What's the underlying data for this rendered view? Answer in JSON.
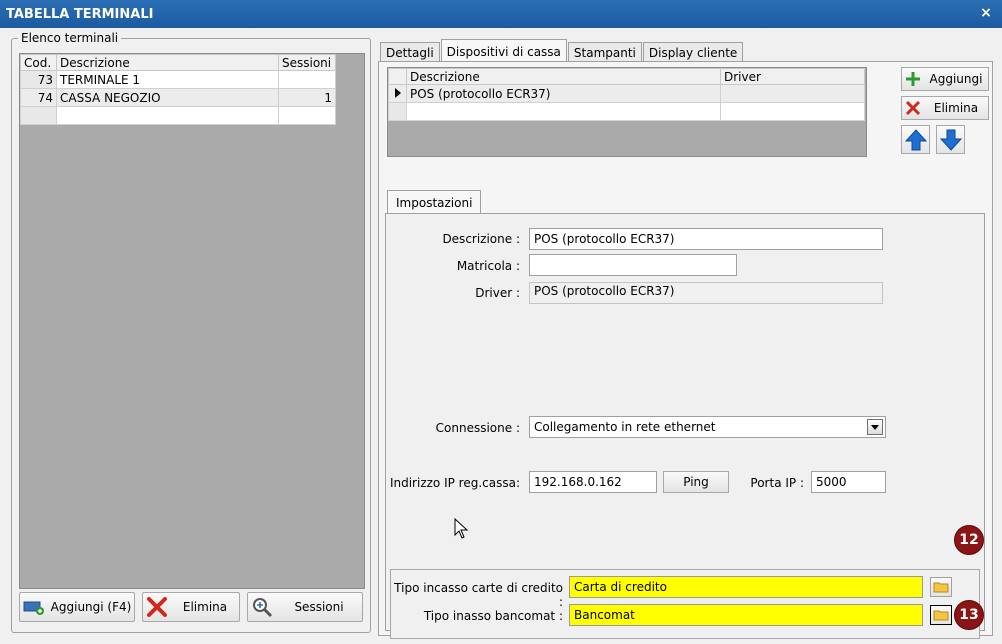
{
  "window": {
    "title": "TABELLA TERMINALI",
    "close_glyph": "×"
  },
  "left": {
    "group_label": "Elenco terminali",
    "columns": [
      "Cod.",
      "Descrizione",
      "Sessioni"
    ],
    "rows": [
      {
        "cod": "73",
        "descr": "TERMINALE 1",
        "sessioni": ""
      },
      {
        "cod": "74",
        "descr": "CASSA NEGOZIO",
        "sessioni": "1"
      }
    ],
    "buttons": {
      "add": "Aggiungi (F4)",
      "delete": "Elimina",
      "sessions": "Sessioni"
    }
  },
  "tabs": [
    "Dettagli",
    "Dispositivi di cassa",
    "Stampanti",
    "Display cliente"
  ],
  "devices": {
    "columns": [
      "Descrizione",
      "Driver"
    ],
    "rows": [
      {
        "descr": "POS (protocollo ECR37)",
        "driver": ""
      }
    ],
    "add_label": "Aggiungi",
    "delete_label": "Elimina"
  },
  "settings": {
    "tab_label": "Impostazioni",
    "descr_label": "Descrizione :",
    "descr_value": "POS (protocollo ECR37)",
    "matricola_label": "Matricola :",
    "matricola_value": "",
    "driver_label": "Driver :",
    "driver_value": "POS (protocollo ECR37)",
    "connection_label": "Connessione :",
    "connection_value": "Collegamento in rete ethernet",
    "ip_label": "Indirizzo IP reg.cassa:",
    "ip_value": "192.168.0.162",
    "ping_label": "Ping",
    "port_label": "Porta IP :",
    "port_value": "5000",
    "credit_label": "Tipo incasso carte di credito :",
    "credit_value": "Carta di credito",
    "bancomat_label": "Tipo inasso bancomat :",
    "bancomat_value": "Bancomat"
  },
  "badges": [
    "12",
    "13"
  ],
  "colors": {
    "titlebar": "#1c5aa0",
    "highlight_yellow": "#ffff00",
    "badge": "#8a1416",
    "arrow_blue": "#1f6fd0",
    "delete_red": "#d0281c",
    "add_green": "#2e9a2e"
  }
}
